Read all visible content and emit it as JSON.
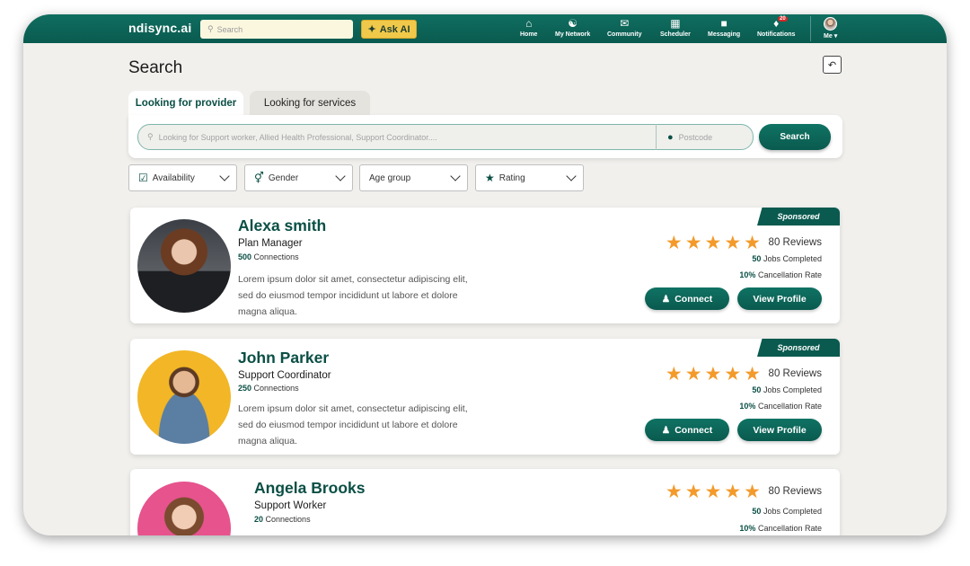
{
  "header": {
    "logo": "ndisync.ai",
    "search_placeholder": "Search",
    "ask_ai_label": "Ask AI",
    "nav": [
      {
        "label": "Home",
        "icon": "home-icon"
      },
      {
        "label": "My Network",
        "icon": "network-icon"
      },
      {
        "label": "Community",
        "icon": "community-icon"
      },
      {
        "label": "Scheduler",
        "icon": "scheduler-icon"
      },
      {
        "label": "Messaging",
        "icon": "messaging-icon"
      },
      {
        "label": "Notifications",
        "icon": "bell-icon",
        "badge": "20"
      }
    ],
    "me_label": "Me"
  },
  "page": {
    "title": "Search",
    "tabs": [
      "Looking for provider",
      "Looking for services"
    ],
    "search_placeholder": "Looking for Support worker, Allied Health Professional, Support Coordinator....",
    "postcode_placeholder": "Postcode",
    "search_button": "Search",
    "filters": [
      "Availability",
      "Gender",
      "Age group",
      "Rating"
    ]
  },
  "results": [
    {
      "name": "Alexa smith",
      "role": "Plan Manager",
      "connections": "500",
      "connections_label": "Connections",
      "description": "Lorem ipsum dolor sit amet, consectetur adipiscing elit, sed do eiusmod tempor incididunt ut labore et dolore magna aliqua.",
      "sponsored": "Sponsored",
      "rating": 5,
      "reviews": "80 Reviews",
      "jobs": "50",
      "jobs_label": "Jobs Completed",
      "cancel": "10%",
      "cancel_label": "Cancellation Rate",
      "connect_label": "Connect",
      "view_label": "View Profile"
    },
    {
      "name": "John Parker",
      "role": "Support Coordinator",
      "connections": "250",
      "connections_label": "Connections",
      "description": "Lorem ipsum dolor sit amet, consectetur adipiscing elit, sed do eiusmod tempor incididunt ut labore et dolore magna aliqua.",
      "sponsored": "Sponsored",
      "rating": 5,
      "reviews": "80 Reviews",
      "jobs": "50",
      "jobs_label": "Jobs Completed",
      "cancel": "10%",
      "cancel_label": "Cancellation Rate",
      "connect_label": "Connect",
      "view_label": "View Profile"
    },
    {
      "name": "Angela Brooks",
      "role": "Support Worker",
      "connections": "20",
      "connections_label": "Connections",
      "rating": 5,
      "reviews": "80 Reviews",
      "jobs": "50",
      "jobs_label": "Jobs Completed",
      "cancel": "10%",
      "cancel_label": "Cancellation Rate"
    }
  ],
  "colors": {
    "brand": "#0a5a4f",
    "accent": "#f1c94a",
    "star": "#f39a2b"
  }
}
